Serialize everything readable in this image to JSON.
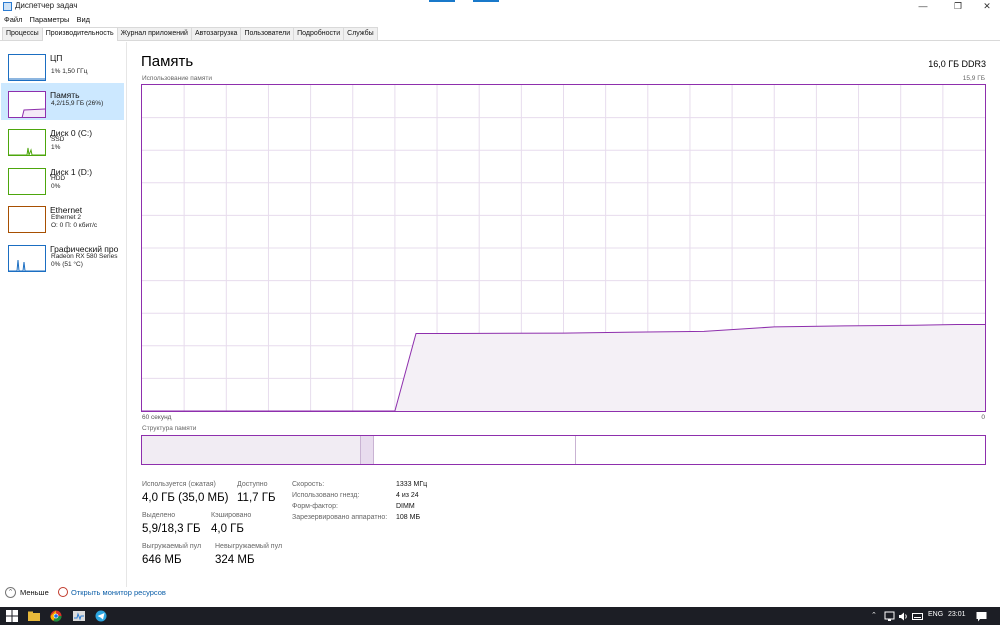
{
  "window": {
    "title": "Диспетчер задач",
    "controls": {
      "minimize": "—",
      "maximize": "❐",
      "close": "✕"
    }
  },
  "menu": [
    "Файл",
    "Параметры",
    "Вид"
  ],
  "tabs": [
    {
      "label": "Процессы",
      "active": false
    },
    {
      "label": "Производительность",
      "active": true
    },
    {
      "label": "Журнал приложений",
      "active": false
    },
    {
      "label": "Автозагрузка",
      "active": false
    },
    {
      "label": "Пользователи",
      "active": false
    },
    {
      "label": "Подробности",
      "active": false
    },
    {
      "label": "Службы",
      "active": false
    }
  ],
  "sidebar": {
    "items": [
      {
        "title": "ЦП",
        "sub1": "1% 1,50 ГГц",
        "sub2": "",
        "sub3": "",
        "color": "#1b6ec2"
      },
      {
        "title": "Память",
        "sub1": "4,2/15,9 ГБ (26%)",
        "sub2": "",
        "sub3": "",
        "color": "#8e2fad"
      },
      {
        "title": "Диск 0 (C:)",
        "sub1": "SSD",
        "sub2": "1%",
        "sub3": "",
        "color": "#4da60c"
      },
      {
        "title": "Диск 1 (D:)",
        "sub1": "HDD",
        "sub2": "0%",
        "sub3": "",
        "color": "#4da60c"
      },
      {
        "title": "Ethernet",
        "sub1": "Ethernet 2",
        "sub2": "О: 0 П: 0 кбит/с",
        "sub3": "",
        "color": "#a74f01"
      },
      {
        "title": "Графический про",
        "sub1": "Radeon RX 580 Series",
        "sub2": "0% (51 °C)",
        "sub3": "",
        "color": "#1b6ec2"
      }
    ]
  },
  "main": {
    "title": "Память",
    "memory_type": "16,0 ГБ DDR3",
    "usage_label": "Использование памяти",
    "usage_max": "15,9 ГБ",
    "axis_left": "60 секунд",
    "axis_right": "0",
    "structure_label": "Структура памяти"
  },
  "stats": {
    "in_use_label": "Используется (сжатая)",
    "in_use_value": "4,0 ГБ (35,0 МБ)",
    "available_label": "Доступно",
    "available_value": "11,7 ГБ",
    "committed_label": "Выделено",
    "committed_value": "5,9/18,3 ГБ",
    "cached_label": "Кэшировано",
    "cached_value": "4,0 ГБ",
    "paged_label": "Выгружаемый пул",
    "paged_value": "646 МБ",
    "nonpaged_label": "Невыгружаемый пул",
    "nonpaged_value": "324 МБ"
  },
  "details": [
    {
      "label": "Скорость:",
      "value": "1333 МГц"
    },
    {
      "label": "Использовано гнезд:",
      "value": "4 из 24"
    },
    {
      "label": "Форм-фактор:",
      "value": "DIMM"
    },
    {
      "label": "Зарезервировано аппаратно:",
      "value": "108 МБ"
    }
  ],
  "chart_data": {
    "type": "area",
    "title": "Использование памяти",
    "xlabel": "",
    "ylabel": "",
    "x_range": [
      60,
      0
    ],
    "ylim": [
      0,
      15.9
    ],
    "grid": true,
    "series": [
      {
        "x": [
          60,
          42,
          40.5,
          38,
          30,
          25,
          20,
          15,
          13,
          10,
          5,
          2,
          0
        ],
        "values": [
          0,
          0,
          3.78,
          3.78,
          3.8,
          3.85,
          3.88,
          4.1,
          4.12,
          4.15,
          4.18,
          4.22,
          4.22
        ]
      }
    ]
  },
  "structure": {
    "in_use_fraction": 0.26,
    "modified_fraction": 0.015,
    "standby_fraction": 0.24
  },
  "footer": {
    "less_label": "Меньше",
    "monitor_label": "Открыть монитор ресурсов"
  },
  "taskbar": {
    "language": "ENG",
    "time": "23:01"
  },
  "colors": {
    "memory_accent": "#8e2fad",
    "memory_fill": "#f4f0f6",
    "grid": "#e7dced",
    "selected_bg": "#cce8ff"
  }
}
